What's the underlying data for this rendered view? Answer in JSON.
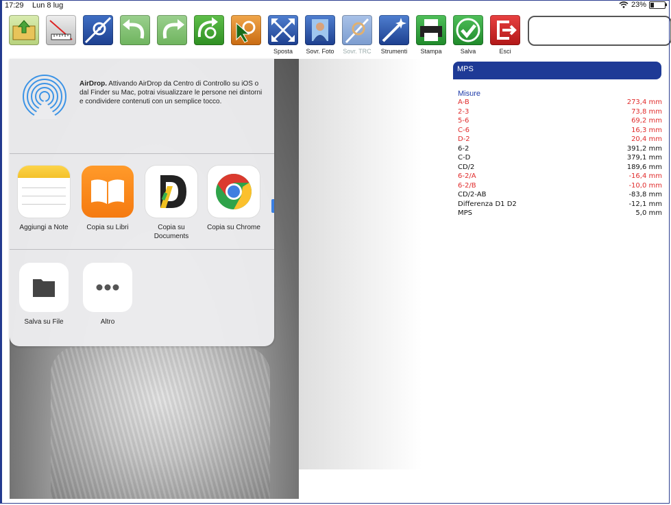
{
  "status": {
    "time": "17:29",
    "date": "Lun 8 lug",
    "battery": "23%",
    "battery_level": 0.23
  },
  "toolbar": {
    "items": [
      {
        "name": "open-folder",
        "label": ""
      },
      {
        "name": "calibra",
        "label": ""
      },
      {
        "name": "point-1",
        "label": ""
      },
      {
        "name": "undo",
        "label": ""
      },
      {
        "name": "redo",
        "label": ""
      },
      {
        "name": "rotate",
        "label": ""
      },
      {
        "name": "point-2",
        "label": ""
      },
      {
        "name": "sposta",
        "label": "Sposta"
      },
      {
        "name": "sovr-foto",
        "label": "Sovr. Foto"
      },
      {
        "name": "sovr-trc",
        "label": "Sovr. TRC"
      },
      {
        "name": "strumenti",
        "label": "Strumenti"
      },
      {
        "name": "stampa",
        "label": "Stampa"
      },
      {
        "name": "salva",
        "label": "Salva"
      },
      {
        "name": "esci",
        "label": "Esci"
      }
    ]
  },
  "share": {
    "airdrop_title": "AirDrop.",
    "airdrop_text": "Attivando AirDrop da Centro di Controllo su iOS o dal Finder su Mac, potrai visualizzare le persone nei dintorni e condividere contenuti con un semplice tocco.",
    "apps": [
      {
        "label": "Aggiungi a Note"
      },
      {
        "label": "Copia su Libri"
      },
      {
        "label": "Copia su Documents"
      },
      {
        "label": "Copia su Chrome"
      }
    ],
    "actions": [
      {
        "label": "Salva su File"
      },
      {
        "label": "Altro"
      }
    ]
  },
  "panel": {
    "header": "MPS",
    "section": "Misure",
    "rows": [
      {
        "name": "A-B",
        "value": "273,4 mm",
        "red": true
      },
      {
        "name": "2-3",
        "value": "73,8 mm",
        "red": true
      },
      {
        "name": "5-6",
        "value": "69,2 mm",
        "red": true
      },
      {
        "name": "C-6",
        "value": "16,3 mm",
        "red": true
      },
      {
        "name": "D-2",
        "value": "20,4 mm",
        "red": true
      },
      {
        "name": "6-2",
        "value": "391,2 mm",
        "red": false
      },
      {
        "name": "C-D",
        "value": "379,1 mm",
        "red": false
      },
      {
        "name": "CD/2",
        "value": "189,6 mm",
        "red": false
      },
      {
        "name": "6-2/A",
        "value": "-16,4 mm",
        "red": true
      },
      {
        "name": "6-2/B",
        "value": "-10,0 mm",
        "red": true
      },
      {
        "name": "CD/2-AB",
        "value": "-83,8 mm",
        "red": false
      },
      {
        "name": "Differenza D1 D2",
        "value": "-12,1 mm",
        "red": false
      },
      {
        "name": "MPS",
        "value": "5,0 mm",
        "red": false
      }
    ]
  }
}
